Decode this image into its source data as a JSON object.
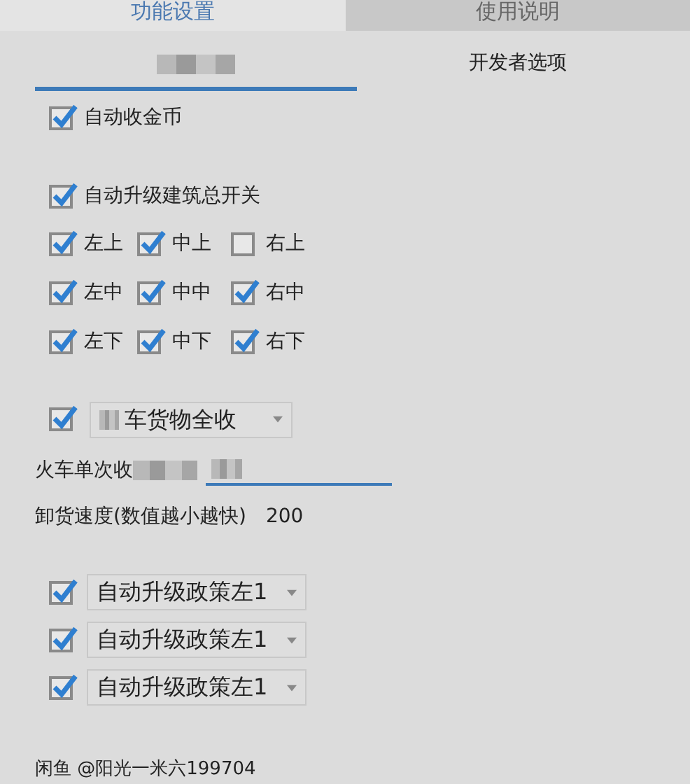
{
  "top_tabs": [
    {
      "label": "功能设置",
      "selected": true
    },
    {
      "label": "使用说明",
      "selected": false
    }
  ],
  "sub_tabs": [
    {
      "redacted": true,
      "selected": true
    },
    {
      "label": "开发者选项",
      "redacted": false,
      "selected": false
    }
  ],
  "auto_coins": {
    "label": "自动收金币",
    "checked": true
  },
  "auto_upgrade": {
    "label": "自动升级建筑总开关",
    "checked": true
  },
  "positions": [
    {
      "label": "左上",
      "checked": true
    },
    {
      "label": "中上",
      "checked": true
    },
    {
      "label": "右上",
      "checked": false
    },
    {
      "label": "左中",
      "checked": true
    },
    {
      "label": "中中",
      "checked": true
    },
    {
      "label": "右中",
      "checked": true
    },
    {
      "label": "左下",
      "checked": true
    },
    {
      "label": "中下",
      "checked": true
    },
    {
      "label": "右下",
      "checked": true
    }
  ],
  "train_collect": {
    "checked": true,
    "value": "车货物全收"
  },
  "train_interval": {
    "label": "火车单次收"
  },
  "unload_speed": {
    "label": "卸货速度(数值越小越快)",
    "value": "200"
  },
  "policies": [
    {
      "checked": true,
      "value": "自动升级政策左1"
    },
    {
      "checked": true,
      "value": "自动升级政策左1"
    },
    {
      "checked": true,
      "value": "自动升级政策左1"
    }
  ],
  "footer": "闲鱼 @阳光一米六199704"
}
